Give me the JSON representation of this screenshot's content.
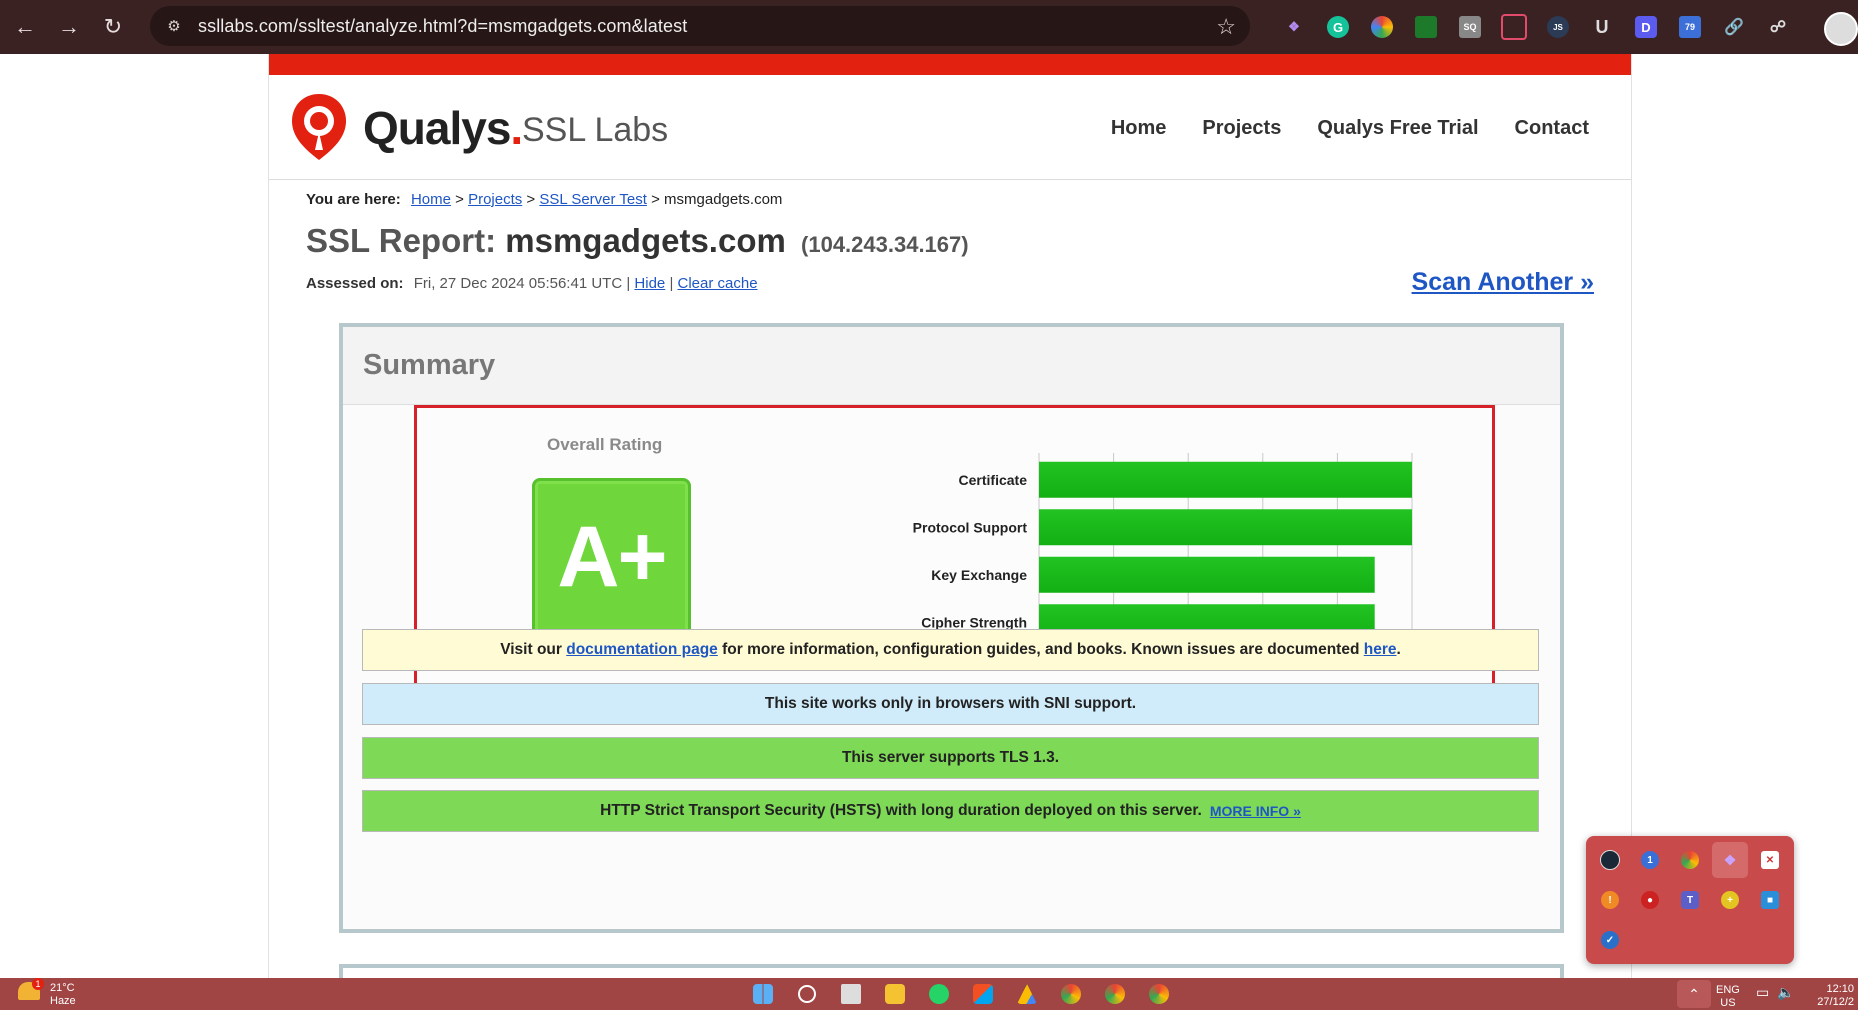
{
  "browser": {
    "url": "ssllabs.com/ssltest/analyze.html?d=msmgadgets.com&latest",
    "nav_icons": [
      "back-icon",
      "forward-icon",
      "reload-icon"
    ]
  },
  "site": {
    "logo_word": "Qualys",
    "logo_dot": ".",
    "logo_sub": "SSL Labs",
    "nav": [
      "Home",
      "Projects",
      "Qualys Free Trial",
      "Contact"
    ]
  },
  "breadcrumb": {
    "prefix": "You are here:",
    "items": [
      "Home",
      "Projects",
      "SSL Server Test"
    ],
    "separator": ">",
    "current": "msmgadgets.com"
  },
  "report": {
    "title_prefix": "SSL Report:",
    "domain": "msmgadgets.com",
    "ip": "(104.243.34.167)",
    "assessed_label": "Assessed on:",
    "assessed_value": "Fri, 27 Dec 2024 05:56:41 UTC |",
    "hide_link": "Hide",
    "pipe": "|",
    "clear_cache_link": "Clear cache",
    "scan_another": "Scan Another »"
  },
  "summary": {
    "title": "Summary",
    "overall_label": "Overall Rating",
    "grade": "A+",
    "colors": {
      "bar": "#13b013",
      "bar_light": "#22c322",
      "grade_bg": "#6fd63c",
      "highlight_border": "#d6202a"
    }
  },
  "chart_data": {
    "type": "bar",
    "orientation": "horizontal",
    "categories": [
      "Certificate",
      "Protocol Support",
      "Key Exchange",
      "Cipher Strength"
    ],
    "values": [
      100,
      100,
      90,
      90
    ],
    "xlim": [
      0,
      100
    ],
    "xticks": [
      0,
      20,
      40,
      60,
      80,
      100
    ],
    "grid": true
  },
  "notes": {
    "docs_pre": "Visit our",
    "docs_link": "documentation page",
    "docs_mid": "for more information, configuration guides, and books. Known issues are documented",
    "docs_here": "here",
    "docs_end": ".",
    "sni": "This site works only in browsers with SNI support.",
    "tls": "This server supports TLS 1.3.",
    "hsts": "HTTP Strict Transport Security (HSTS) with long duration deployed on this server.",
    "hsts_more": "MORE INFO »"
  },
  "taskbar": {
    "weather_temp": "21°C",
    "weather_desc": "Haze",
    "weather_badge": "1",
    "lang_top": "ENG",
    "lang_bottom": "US",
    "time": "12:10",
    "date": "27/12/2"
  }
}
